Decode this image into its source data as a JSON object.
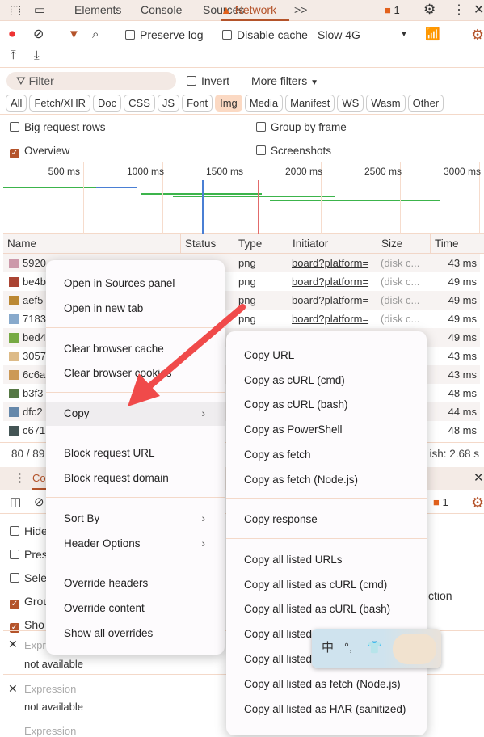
{
  "tabs": {
    "items": [
      "Elements",
      "Console",
      "Sources",
      "Network"
    ],
    "active": "Network",
    "more": ">>",
    "issues": "1"
  },
  "toolbar": {
    "preserve_log": "Preserve log",
    "disable_cache": "Disable cache",
    "throttle": "Slow 4G"
  },
  "filter": {
    "placeholder": "Filter",
    "invert": "Invert",
    "more_filters": "More filters",
    "types": [
      "All",
      "Fetch/XHR",
      "Doc",
      "CSS",
      "JS",
      "Font",
      "Img",
      "Media",
      "Manifest",
      "WS",
      "Wasm",
      "Other"
    ],
    "active_type": "Img"
  },
  "options": {
    "big_rows": "Big request rows",
    "group_frame": "Group by frame",
    "overview": "Overview",
    "screenshots": "Screenshots"
  },
  "timeline": {
    "ticks": [
      "500 ms",
      "1000 ms",
      "1500 ms",
      "2000 ms",
      "2500 ms",
      "3000 ms"
    ]
  },
  "table": {
    "headers": [
      "Name",
      "Status",
      "Type",
      "Initiator",
      "Size",
      "Time"
    ],
    "rows": [
      {
        "name": "5920",
        "type": "png",
        "initiator": "board?platform=",
        "size": "(disk c...",
        "time": "43 ms"
      },
      {
        "name": "be4b",
        "type": "png",
        "initiator": "board?platform=",
        "size": "(disk c...",
        "time": "49 ms"
      },
      {
        "name": "aef5",
        "type": "png",
        "initiator": "board?platform=",
        "size": "(disk c...",
        "time": "49 ms"
      },
      {
        "name": "7183",
        "type": "png",
        "initiator": "board?platform=",
        "size": "(disk c...",
        "time": "49 ms"
      },
      {
        "name": "bed4",
        "type": "",
        "initiator": "",
        "size": "",
        "time": "49 ms"
      },
      {
        "name": "3057",
        "type": "",
        "initiator": "",
        "size": "",
        "time": "43 ms"
      },
      {
        "name": "6c6a",
        "type": "",
        "initiator": "",
        "size": "",
        "time": "43 ms"
      },
      {
        "name": "b3f3",
        "type": "",
        "initiator": "",
        "size": "",
        "time": "48 ms"
      },
      {
        "name": "dfc2",
        "type": "",
        "initiator": "",
        "size": "",
        "time": "44 ms"
      },
      {
        "name": "c671",
        "type": "",
        "initiator": "",
        "size": "",
        "time": "48 ms"
      }
    ]
  },
  "status": {
    "count": "80 / 89",
    "finish": "ish: 2.68 s"
  },
  "drawer": {
    "tab": "Co",
    "issues": "1",
    "checks": [
      "Hide",
      "Pres",
      "Sele",
      "Grou",
      "Sho"
    ],
    "right_text": "ction",
    "expressions": [
      {
        "label": "Expr",
        "value": "not available"
      },
      {
        "label": "Expression",
        "value": "not available"
      },
      {
        "label": "Expression",
        "value": ""
      }
    ]
  },
  "context_menu": {
    "items": [
      "Open in Sources panel",
      "Open in new tab",
      "Clear browser cache",
      "Clear browser cookies",
      "Copy",
      "Block request URL",
      "Block request domain",
      "Sort By",
      "Header Options",
      "Override headers",
      "Override content",
      "Show all overrides"
    ]
  },
  "copy_submenu": {
    "items": [
      "Copy URL",
      "Copy as cURL (cmd)",
      "Copy as cURL (bash)",
      "Copy as PowerShell",
      "Copy as fetch",
      "Copy as fetch (Node.js)",
      "Copy response",
      "Copy all listed URLs",
      "Copy all listed as cURL (cmd)",
      "Copy all listed as cURL (bash)",
      "Copy all listed",
      "Copy all listed",
      "Copy all listed as fetch (Node.js)",
      "Copy all listed as HAR (sanitized)"
    ]
  },
  "ime": {
    "lang": "中",
    "punct": "°,"
  },
  "colors": {
    "accent": "#b4532a",
    "annotation_arrow": "#f04a4a"
  }
}
